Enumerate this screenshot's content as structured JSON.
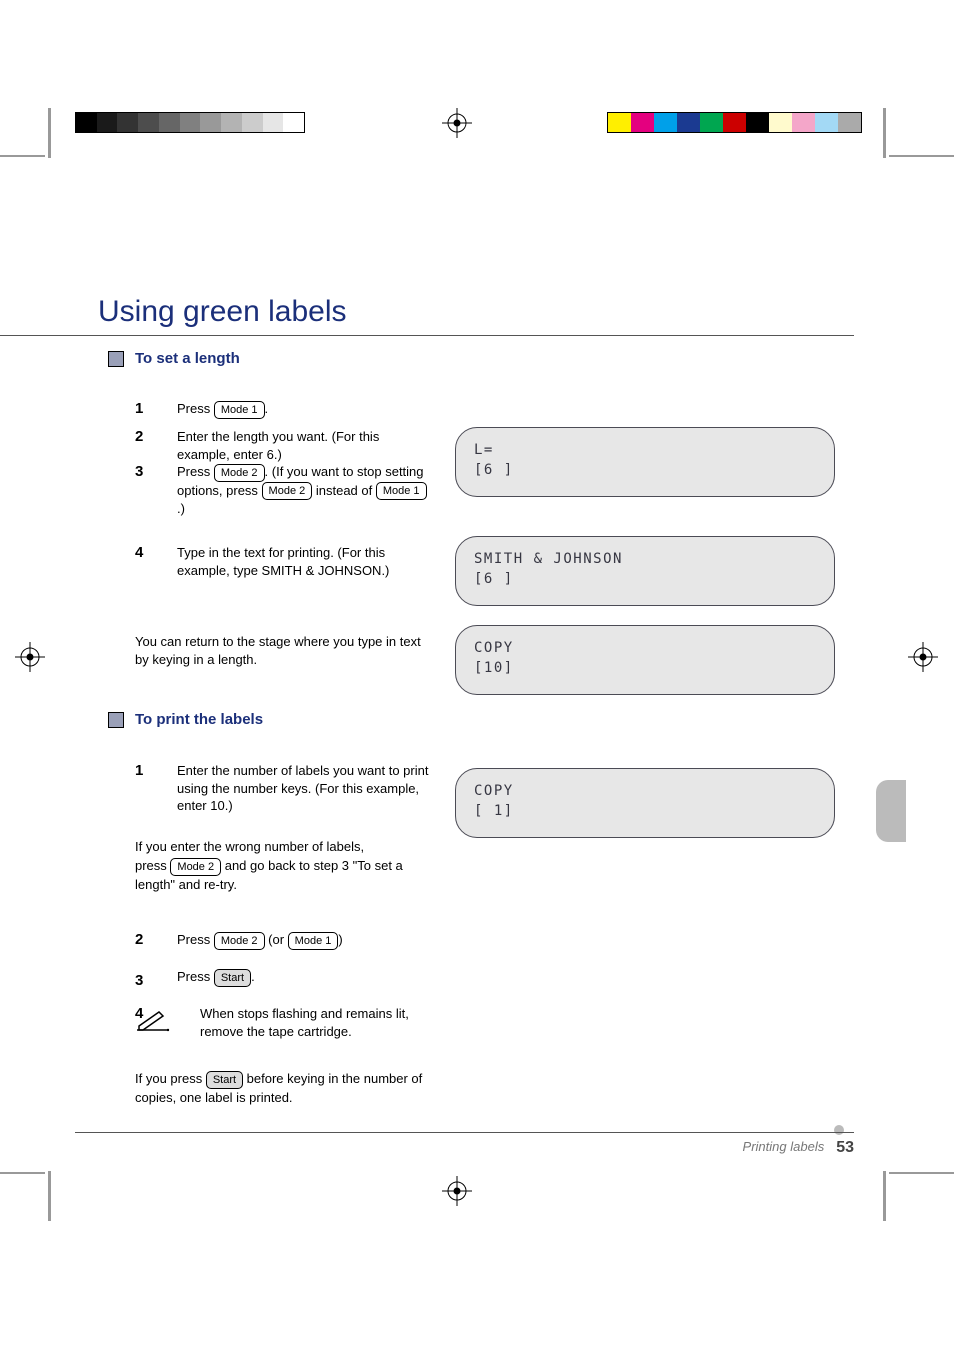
{
  "chapter_title": "Using green labels",
  "sec1": {
    "heading": "To set a length",
    "steps": {
      "s1": {
        "n": "1",
        "text_a": "Press ",
        "text_b": ".",
        "key": "Mode 1"
      },
      "s2": {
        "n": "2",
        "text": "Enter the length you want. (For this example, enter 6.)"
      },
      "s3": {
        "n": "3",
        "text_a": "Press ",
        "text_b": ". (If you want to stop setting options, press ",
        "text_c": " instead of ",
        "text_d": ".)",
        "k1": "Mode 2",
        "k2": "Mode 2",
        "k3": "Mode 1"
      },
      "s4": {
        "n": "4",
        "text": "Type in the text for printing. (For this example, type SMITH & JOHNSON.)"
      }
    },
    "note": "You can return to the stage where you type in text by keying in a length."
  },
  "sec2": {
    "heading": "To print the labels",
    "s1": {
      "n": "1",
      "text": "Enter the number of labels you want to print using the number keys. (For this example, enter 10.)"
    },
    "note1": "If you enter the wrong number of labels,",
    "note2": {
      "a": "press ",
      "b": " and go back to step 3 \"To set a length\" and re-try.",
      "key": "Mode 2"
    },
    "s2": {
      "n": "2",
      "text_a": "Press ",
      "text_b": " (or ",
      "text_c": ")",
      "k1": "Mode 2",
      "k2": "Mode 1"
    },
    "s3": {
      "n": "3",
      "text_a": "Press ",
      "text_b": ".",
      "key": "Start"
    },
    "s4": {
      "n": "4",
      "icon": "write-icon",
      "text": "When stops flashing and remains lit, remove the tape cartridge."
    },
    "note3": {
      "a": "If you press ",
      "b": " before keying in the number of copies, one label is printed.",
      "key": "Start"
    }
  },
  "lcd": {
    "p1": {
      "l1": "L=",
      "l2": "[6 ]"
    },
    "p2": {
      "l1": "SMITH & JOHNSON",
      "l2": "[6 ]"
    },
    "p3": {
      "l1": "COPY",
      "l2": "[10]"
    },
    "p4": {
      "l1": "COPY",
      "l2": "[ 1]"
    }
  },
  "footer": {
    "section": "Printing labels",
    "page": "53"
  },
  "keys": {
    "mode1": "Mode 1",
    "mode2": "Mode 2",
    "start": "Start"
  }
}
